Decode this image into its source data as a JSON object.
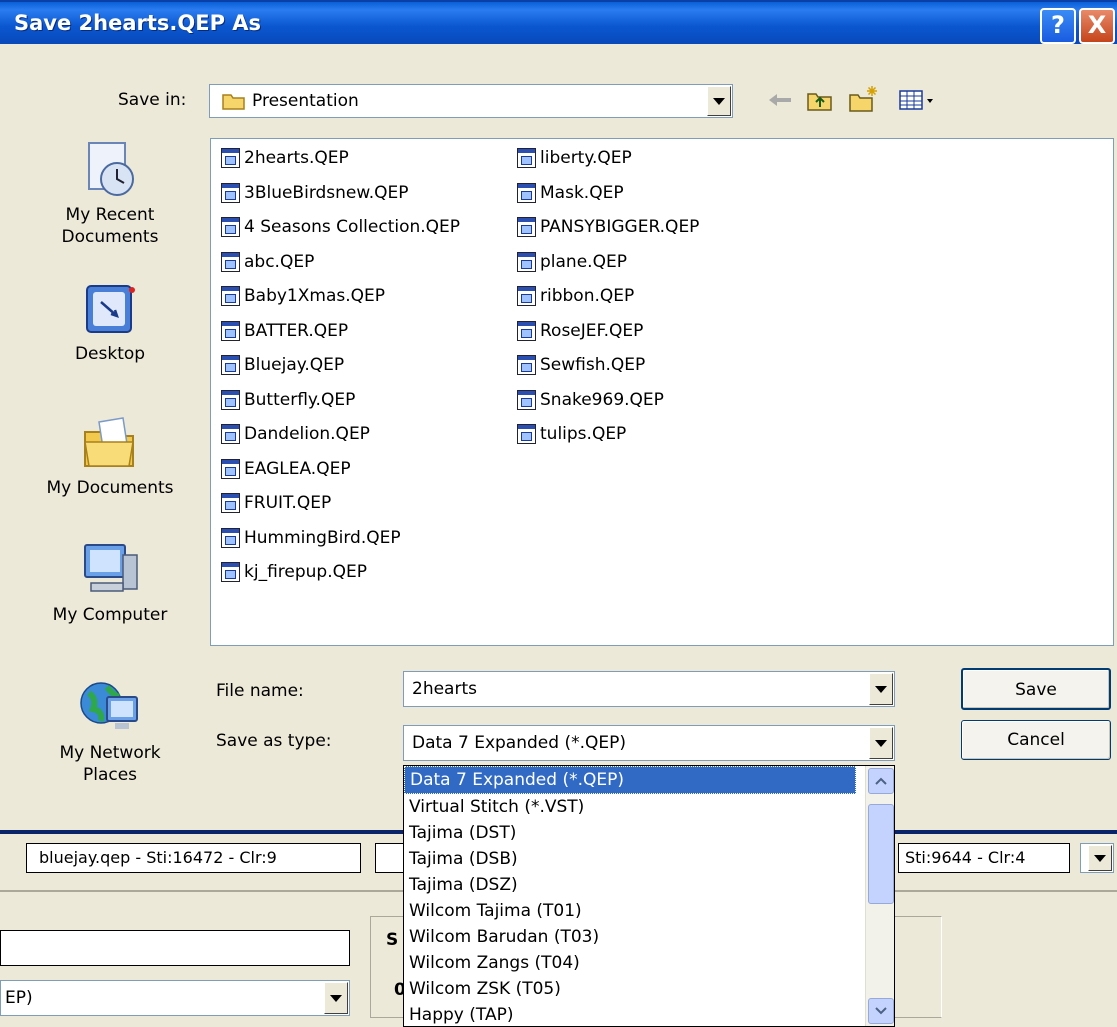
{
  "window": {
    "title": "Save 2hearts.QEP As",
    "help_glyph": "?",
    "close_glyph": "X"
  },
  "save_in": {
    "label": "Save in:",
    "value": "Presentation"
  },
  "toolbar": {
    "icons": [
      "back-arrow-icon",
      "up-folder-icon",
      "new-folder-icon",
      "views-menu-icon"
    ]
  },
  "places": [
    {
      "name": "my-recent-documents",
      "label_line1": "My Recent",
      "label_line2": "Documents"
    },
    {
      "name": "desktop",
      "label_line1": "Desktop",
      "label_line2": ""
    },
    {
      "name": "my-documents",
      "label_line1": "My Documents",
      "label_line2": ""
    },
    {
      "name": "my-computer",
      "label_line1": "My Computer",
      "label_line2": ""
    },
    {
      "name": "my-network-places",
      "label_line1": "My Network",
      "label_line2": "Places"
    }
  ],
  "files_col1": [
    "2hearts.QEP",
    "3BlueBirdsnew.QEP",
    "4 Seasons Collection.QEP",
    "abc.QEP",
    "Baby1Xmas.QEP",
    "BATTER.QEP",
    "Bluejay.QEP",
    "Butterfly.QEP",
    "Dandelion.QEP",
    "EAGLEA.QEP",
    "FRUIT.QEP",
    "HummingBird.QEP",
    "kj_firepup.QEP"
  ],
  "files_col2": [
    "liberty.QEP",
    "Mask.QEP",
    "PANSYBIGGER.QEP",
    "plane.QEP",
    "ribbon.QEP",
    "RoseJEF.QEP",
    "Sewfish.QEP",
    "Snake969.QEP",
    "tulips.QEP"
  ],
  "file_name": {
    "label": "File name:",
    "value": "2hearts"
  },
  "save_type": {
    "label": "Save as type:",
    "value": "Data 7 Expanded (*.QEP)",
    "options": [
      "Data 7 Expanded (*.QEP)",
      "Virtual Stitch (*.VST)",
      "Tajima (DST)",
      "Tajima (DSB)",
      "Tajima (DSZ)",
      "Wilcom Tajima (T01)",
      "Wilcom Barudan (T03)",
      "Wilcom Zangs (T04)",
      "Wilcom ZSK (T05)",
      "Happy (TAP)"
    ]
  },
  "buttons": {
    "save": "Save",
    "cancel": "Cancel"
  },
  "background_app": {
    "status_left": "bluejay.qep - Sti:16472 - Clr:9",
    "status_right": "Sti:9644 - Clr:4",
    "partial_label_1": "S",
    "partial_label_2": "0",
    "partial_combo": "EP)"
  }
}
